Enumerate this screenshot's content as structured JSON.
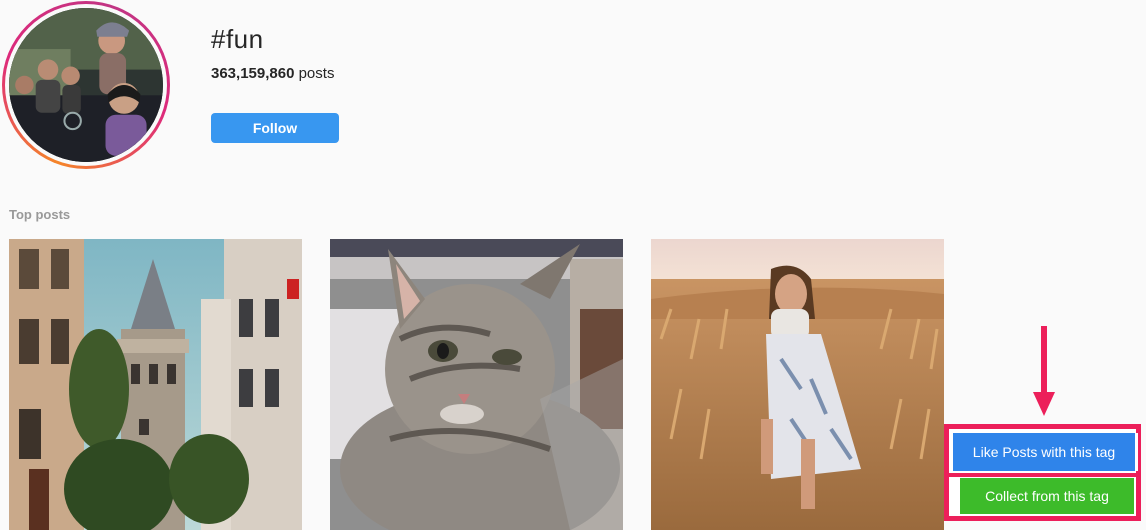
{
  "header": {
    "hashtag": "#fun",
    "post_count": "363,159,860",
    "post_count_suffix": " posts",
    "follow_label": "Follow"
  },
  "top_posts": {
    "title": "Top posts",
    "items": [
      {
        "subject": "galata-tower-street"
      },
      {
        "subject": "tabby-kitten"
      },
      {
        "subject": "woman-in-wheat-field"
      }
    ]
  },
  "extension": {
    "like_label": "Like Posts with this tag",
    "collect_label": "Collect from this tag",
    "accent_color": "#ec1f5a",
    "like_color": "#2f84ea",
    "collect_color": "#3dbb2a"
  },
  "colors": {
    "follow_button": "#3897f0",
    "background": "#fafafa"
  }
}
